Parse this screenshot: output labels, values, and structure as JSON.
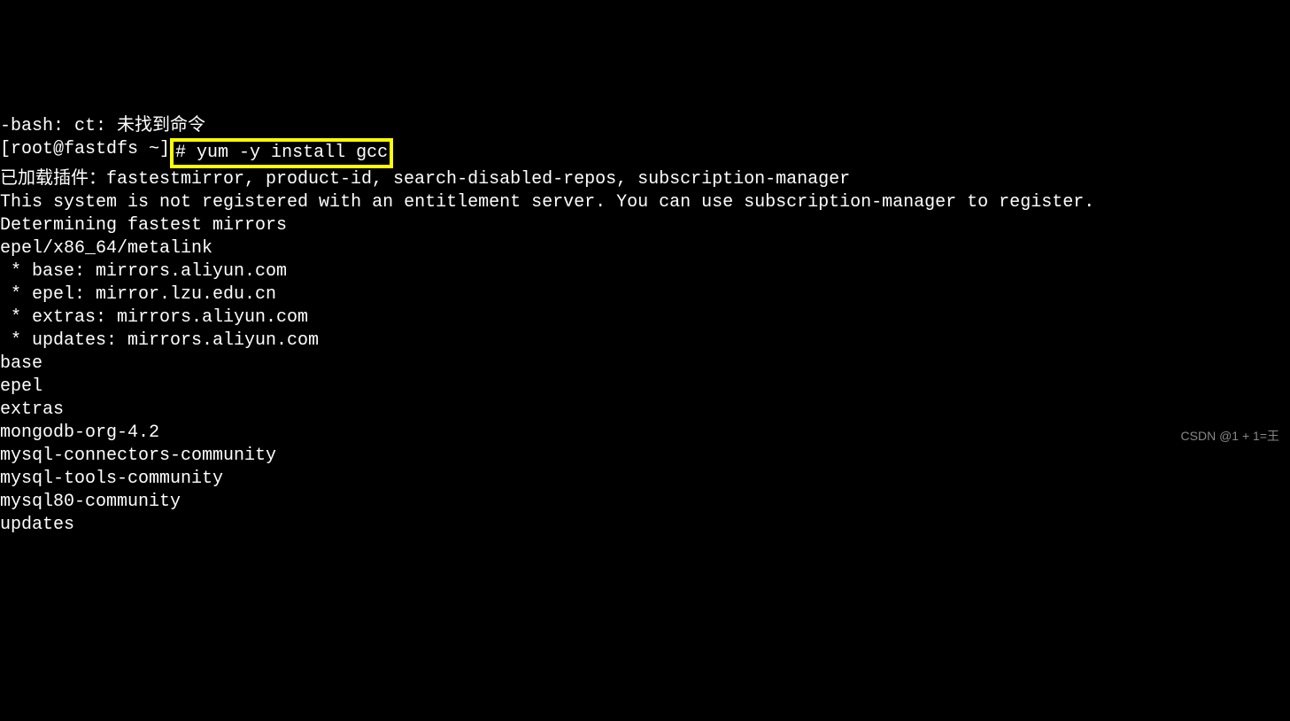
{
  "terminal": {
    "line0": "-bash: ct: 未找到命令",
    "prompt_user": "[root@fastdfs ~]",
    "prompt_symbol": "# ",
    "command": "yum -y install gcc",
    "line2": "已加载插件：fastestmirror, product-id, search-disabled-repos, subscription-manager",
    "line3": "",
    "line4": "This system is not registered with an entitlement server. You can use subscription-manager to register.",
    "line5": "",
    "line6": "Determining fastest mirrors",
    "line7": "epel/x86_64/metalink",
    "line8": " * base: mirrors.aliyun.com",
    "line9": " * epel: mirror.lzu.edu.cn",
    "line10": " * extras: mirrors.aliyun.com",
    "line11": " * updates: mirrors.aliyun.com",
    "line12": "base",
    "line13": "epel",
    "line14": "extras",
    "line15": "mongodb-org-4.2",
    "line16": "mysql-connectors-community",
    "line17": "mysql-tools-community",
    "line18": "mysql80-community",
    "line19": "updates"
  },
  "watermark": "CSDN @1 + 1=王"
}
